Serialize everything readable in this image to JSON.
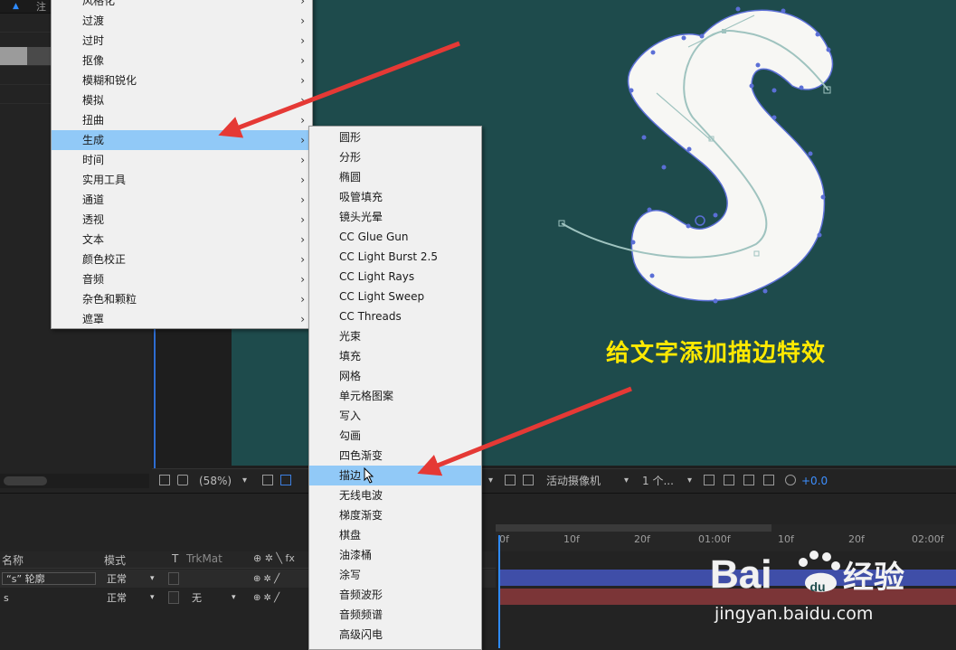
{
  "left_panel": {
    "tab_label": "注"
  },
  "menu_main": {
    "items": [
      {
        "label": "风格化",
        "has_submenu": true
      },
      {
        "label": "过渡",
        "has_submenu": true
      },
      {
        "label": "过时",
        "has_submenu": true
      },
      {
        "label": "抠像",
        "has_submenu": true
      },
      {
        "label": "模糊和锐化",
        "has_submenu": true
      },
      {
        "label": "模拟",
        "has_submenu": true
      },
      {
        "label": "扭曲",
        "has_submenu": true
      },
      {
        "label": "生成",
        "has_submenu": true,
        "highlighted": true
      },
      {
        "label": "时间",
        "has_submenu": true
      },
      {
        "label": "实用工具",
        "has_submenu": true
      },
      {
        "label": "通道",
        "has_submenu": true
      },
      {
        "label": "透视",
        "has_submenu": true
      },
      {
        "label": "文本",
        "has_submenu": true
      },
      {
        "label": "颜色校正",
        "has_submenu": true
      },
      {
        "label": "音频",
        "has_submenu": true
      },
      {
        "label": "杂色和颗粒",
        "has_submenu": true
      },
      {
        "label": "遮罩",
        "has_submenu": true
      }
    ],
    "arrow": "›"
  },
  "menu_sub": {
    "items": [
      "圆形",
      "分形",
      "椭圆",
      "吸管填充",
      "镜头光晕",
      "CC Glue Gun",
      "CC Light Burst 2.5",
      "CC Light Rays",
      "CC Light Sweep",
      "CC Threads",
      "光束",
      "填充",
      "网格",
      "单元格图案",
      "写入",
      "勾画",
      "四色渐变",
      "描边",
      "无线电波",
      "梯度渐变",
      "棋盘",
      "油漆桶",
      "涂写",
      "音频波形",
      "音频频谱",
      "高级闪电"
    ],
    "highlighted": "描边"
  },
  "viewer_toolbar": {
    "zoom": "(58%)",
    "camera": "活动摄像机",
    "views": "1 个...",
    "exposure": "+0.0"
  },
  "timeline": {
    "headers": {
      "name": "名称",
      "mode": "模式",
      "t": "T",
      "trkmat": "TrkMat"
    },
    "layers": [
      {
        "name": "“s” 轮廓",
        "mode": "正常",
        "trkmat": ""
      },
      {
        "name": "s",
        "mode": "正常",
        "trkmat": "无"
      }
    ],
    "ruler": [
      "0f",
      "10f",
      "20f",
      "01:00f",
      "10f",
      "20f",
      "02:00f"
    ]
  },
  "annotation": {
    "caption": "给文字添加描边特效"
  },
  "watermark": {
    "brand": "Bai",
    "brand_cn": "经验",
    "url": "jingyan.baidu.com"
  },
  "colors": {
    "composition_bg": "#1e4b4c",
    "menu_highlight": "#91c9f7",
    "caption": "#ffe900",
    "arrow": "#e53935",
    "accent": "#2e8bff"
  }
}
